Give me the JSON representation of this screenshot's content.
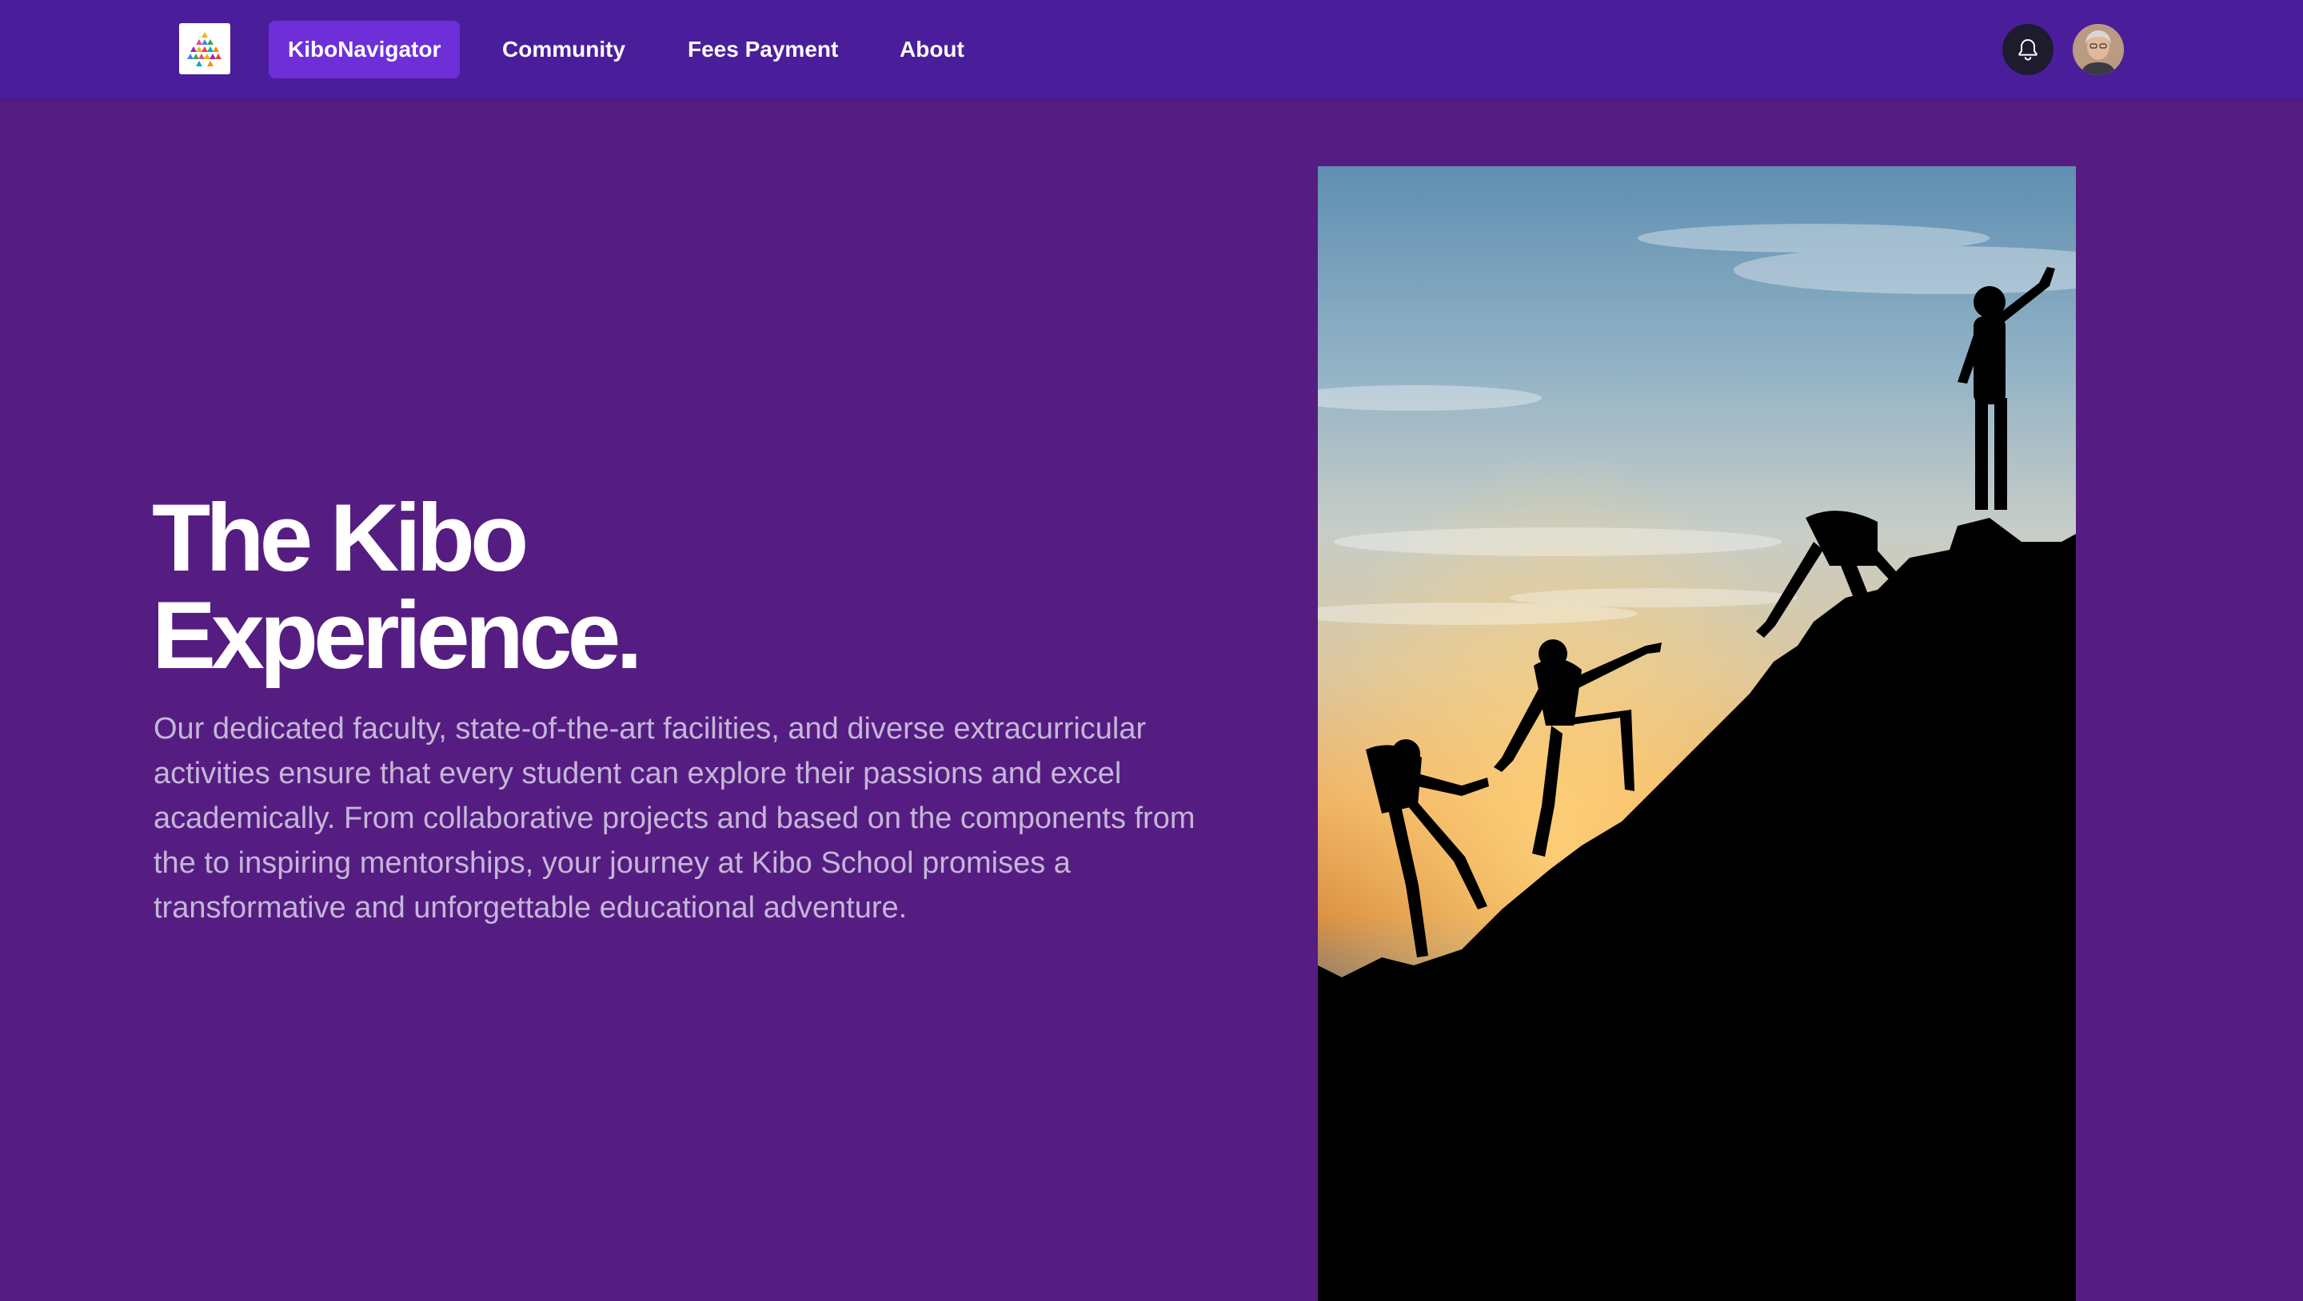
{
  "nav": {
    "logo_icon": "kibo-triangles-logo-icon",
    "links": [
      {
        "label": "KiboNavigator",
        "active": true
      },
      {
        "label": "Community",
        "active": false
      },
      {
        "label": "Fees Payment",
        "active": false
      },
      {
        "label": "About",
        "active": false
      }
    ],
    "notification_icon": "bell-icon",
    "avatar_icon": "user-avatar"
  },
  "hero": {
    "title_line1": "The Kibo",
    "title_line2": "Experience.",
    "description": "Our dedicated faculty, state-of-the-art facilities, and diverse extracurricular activities ensure that every student can explore their passions and excel academically. From collaborative projects and based on the components from the to inspiring mentorships, your journey at Kibo School promises a transformative and unforgettable educational adventure.",
    "image_subject": "climbers-silhouette-sunset-image"
  },
  "colors": {
    "page_background": "#551d81",
    "navbar_background": "#4a1e9a",
    "active_link": "#6e2fd9",
    "body_text": "#c4b6d8"
  }
}
